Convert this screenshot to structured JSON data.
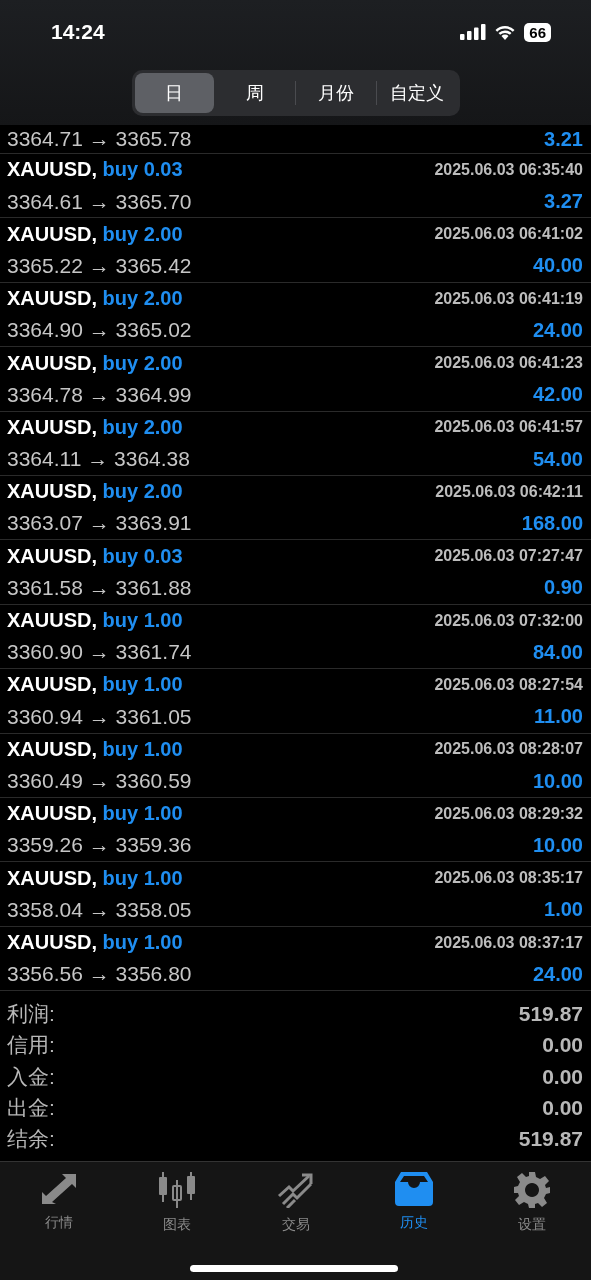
{
  "status_bar": {
    "time": "14:24",
    "battery": "66"
  },
  "period_tabs": [
    {
      "label": "日",
      "selected": true
    },
    {
      "label": "周",
      "selected": false
    },
    {
      "label": "月份",
      "selected": false
    },
    {
      "label": "自定义",
      "selected": false
    }
  ],
  "deals": [
    {
      "kind": "cut",
      "prices": "3364.71 → 3365.78",
      "profit": "3.21"
    },
    {
      "kind": "full",
      "symbol": "XAUUSD,",
      "order": "buy 0.03",
      "time": "2025.06.03 06:35:40",
      "prices": "3364.61 → 3365.70",
      "profit": "3.27"
    },
    {
      "kind": "full",
      "symbol": "XAUUSD,",
      "order": "buy 2.00",
      "time": "2025.06.03 06:41:02",
      "prices": "3365.22 → 3365.42",
      "profit": "40.00"
    },
    {
      "kind": "full",
      "symbol": "XAUUSD,",
      "order": "buy 2.00",
      "time": "2025.06.03 06:41:19",
      "prices": "3364.90 → 3365.02",
      "profit": "24.00"
    },
    {
      "kind": "full",
      "symbol": "XAUUSD,",
      "order": "buy 2.00",
      "time": "2025.06.03 06:41:23",
      "prices": "3364.78 → 3364.99",
      "profit": "42.00"
    },
    {
      "kind": "full",
      "symbol": "XAUUSD,",
      "order": "buy 2.00",
      "time": "2025.06.03 06:41:57",
      "prices": "3364.11 → 3364.38",
      "profit": "54.00"
    },
    {
      "kind": "full",
      "symbol": "XAUUSD,",
      "order": "buy 2.00",
      "time": "2025.06.03 06:42:11",
      "prices": "3363.07 → 3363.91",
      "profit": "168.00"
    },
    {
      "kind": "full",
      "symbol": "XAUUSD,",
      "order": "buy 0.03",
      "time": "2025.06.03 07:27:47",
      "prices": "3361.58 → 3361.88",
      "profit": "0.90"
    },
    {
      "kind": "full",
      "symbol": "XAUUSD,",
      "order": "buy 1.00",
      "time": "2025.06.03 07:32:00",
      "prices": "3360.90 → 3361.74",
      "profit": "84.00"
    },
    {
      "kind": "full",
      "symbol": "XAUUSD,",
      "order": "buy 1.00",
      "time": "2025.06.03 08:27:54",
      "prices": "3360.94 → 3361.05",
      "profit": "11.00"
    },
    {
      "kind": "full",
      "symbol": "XAUUSD,",
      "order": "buy 1.00",
      "time": "2025.06.03 08:28:07",
      "prices": "3360.49 → 3360.59",
      "profit": "10.00"
    },
    {
      "kind": "full",
      "symbol": "XAUUSD,",
      "order": "buy 1.00",
      "time": "2025.06.03 08:29:32",
      "prices": "3359.26 → 3359.36",
      "profit": "10.00"
    },
    {
      "kind": "full",
      "symbol": "XAUUSD,",
      "order": "buy 1.00",
      "time": "2025.06.03 08:35:17",
      "prices": "3358.04 → 3358.05",
      "profit": "1.00"
    },
    {
      "kind": "full",
      "symbol": "XAUUSD,",
      "order": "buy 1.00",
      "time": "2025.06.03 08:37:17",
      "prices": "3356.56 → 3356.80",
      "profit": "24.00"
    }
  ],
  "summary": [
    {
      "label": "利润:",
      "value": "519.87"
    },
    {
      "label": "信用:",
      "value": "0.00"
    },
    {
      "label": "入金:",
      "value": "0.00"
    },
    {
      "label": "出金:",
      "value": "0.00"
    },
    {
      "label": "结余:",
      "value": "519.87"
    }
  ],
  "tab_bar": [
    {
      "kind": "quotes",
      "label": "行情",
      "selected": false
    },
    {
      "kind": "chart",
      "label": "图表",
      "selected": false
    },
    {
      "kind": "trade",
      "label": "交易",
      "selected": false
    },
    {
      "kind": "history",
      "label": "历史",
      "selected": true
    },
    {
      "kind": "settings",
      "label": "设置",
      "selected": false
    }
  ]
}
